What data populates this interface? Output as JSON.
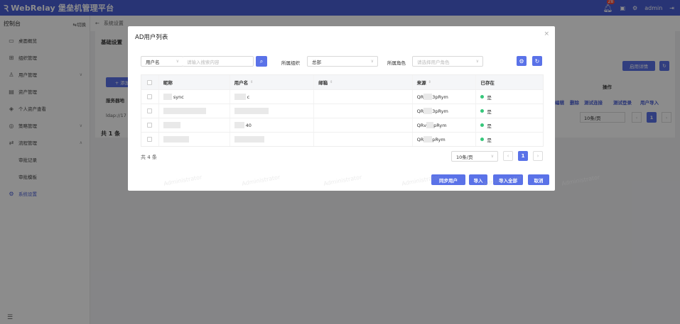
{
  "app": {
    "title": "WebRelay 堡垒机管理平台",
    "notifications": "28",
    "user": "admin"
  },
  "sidebar": {
    "console": "控制台",
    "switch": "切换",
    "items": [
      {
        "label": "桌面概览",
        "icon": "monitor-icon"
      },
      {
        "label": "组织管理",
        "icon": "org-icon"
      },
      {
        "label": "用户管理",
        "icon": "users-icon"
      },
      {
        "label": "资产管理",
        "icon": "asset-icon"
      },
      {
        "label": "个人资产查看",
        "icon": "layers-icon"
      },
      {
        "label": "策略管理",
        "icon": "policy-icon"
      },
      {
        "label": "流程管理",
        "icon": "flow-icon"
      },
      {
        "label": "审批记录"
      },
      {
        "label": "审批模板"
      },
      {
        "label": "系统设置",
        "icon": "gear-icon"
      }
    ]
  },
  "breadcrumb": "系统设置",
  "background": {
    "tab": "基础设置",
    "add": "+ 添加",
    "col_server": "服务器地",
    "server_value": "ldap://17",
    "total": "共 1 条",
    "enable_details": "启用详情",
    "actions_header": "操作",
    "actions": [
      "编辑",
      "删除",
      "测试连接",
      "测试登录",
      "用户导入"
    ],
    "page_size": "10条/页",
    "page": "1"
  },
  "modal": {
    "title": "AD用户列表",
    "search_field": "用户名",
    "search_placeholder": "请输入搜索内容",
    "org_label": "所属组织",
    "org_value": "总部",
    "role_label": "所属角色",
    "role_placeholder": "请选择用户角色",
    "columns": [
      "昵称",
      "用户名",
      "邮箱",
      "来源",
      "已存在"
    ],
    "rows": [
      {
        "nickname": "sync",
        "username": "c",
        "email": "",
        "source_a": "QR",
        "source_b": "3pRym",
        "exists": "是"
      },
      {
        "nickname": "",
        "username": "",
        "email": "",
        "source_a": "QR",
        "source_b": "3pRym",
        "exists": "是"
      },
      {
        "nickname": "",
        "username": "40",
        "email": "",
        "source_a": "QRv",
        "source_b": "pRym",
        "exists": "是"
      },
      {
        "nickname": "",
        "username": "",
        "email": "",
        "source_a": "QR",
        "source_b": "pRym",
        "exists": "是"
      }
    ],
    "total": "共 4 条",
    "page_size": "10条/页",
    "page": "1",
    "buttons": {
      "sync": "同步用户",
      "import": "导入",
      "import_all": "导入全部",
      "cancel": "取消"
    }
  },
  "watermark": "Administrator",
  "colors": {
    "primary": "#4a5fd6",
    "button": "#5a72e8",
    "success": "#36c77b"
  }
}
